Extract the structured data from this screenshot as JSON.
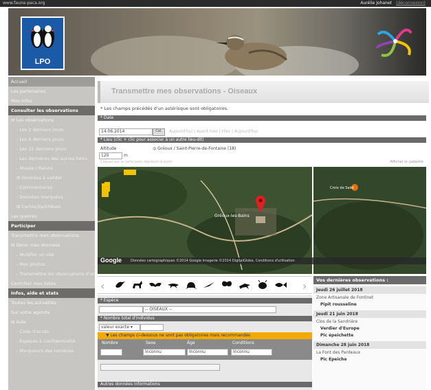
{
  "topbar": {
    "site": "www.faune-paca.org",
    "user": "Aurélie Johanet",
    "logout": "(déconnexion)"
  },
  "logo": {
    "text": "LPO"
  },
  "sidebar": {
    "items": [
      {
        "label": "Accueil",
        "type": "top"
      },
      {
        "label": "Les partenaires",
        "type": "item"
      },
      {
        "label": "Mes infos",
        "type": "item"
      },
      {
        "label": "Consulter les observations",
        "type": "head"
      },
      {
        "label": "⊟ Les observations",
        "type": "item"
      },
      {
        "label": "- Les 2 derniers jours",
        "type": "sub"
      },
      {
        "label": "- Les 5 derniers jours",
        "type": "sub"
      },
      {
        "label": "- Les 15 derniers jours",
        "type": "sub"
      },
      {
        "label": "- Les dernières des autres listes",
        "type": "sub"
      },
      {
        "label": "- Musée / Rareté",
        "type": "sub"
      },
      {
        "label": "⊞ Données à valider",
        "type": "sub"
      },
      {
        "label": "- Commentaires",
        "type": "sub"
      },
      {
        "label": "- Données marquées",
        "type": "sub"
      },
      {
        "label": "⊞ Cartes/Synthèses",
        "type": "sub"
      },
      {
        "label": "Les guerres",
        "type": "item"
      },
      {
        "label": "Participer",
        "type": "head"
      },
      {
        "label": "Transmettre mes observations",
        "type": "item"
      },
      {
        "label": "⊟ Gérer mes données",
        "type": "item"
      },
      {
        "label": "- Modifier un site",
        "type": "sub"
      },
      {
        "label": "- Mes photos",
        "type": "sub"
      },
      {
        "label": "- Transmettre les observations d'un ...",
        "type": "sub"
      },
      {
        "label": "Contrôler mes listes",
        "type": "item"
      },
      {
        "label": "Infos, aide et stats",
        "type": "head"
      },
      {
        "label": "Toutes les actualités",
        "type": "item"
      },
      {
        "label": "Sur votre agenda",
        "type": "item"
      },
      {
        "label": "⊟ Aide",
        "type": "item"
      },
      {
        "label": "- Code d'accès",
        "type": "sub"
      },
      {
        "label": "- Espèces à confidentialité",
        "type": "sub"
      },
      {
        "label": "- Marqueurs des nombres",
        "type": "sub"
      }
    ]
  },
  "main": {
    "title": "Transmettre mes observations - Oiseaux",
    "required_note": "* Les champs précédés d'un astérisque sont obligatoires.",
    "date_bar": "* Date",
    "date_value": "14.06.2014",
    "date_button": "Cal.",
    "date_links": "Aujourd'hui | Avant-hier | Hier | Aujourd'hui",
    "lieu_bar": "* Lieu (clic + clic pour associer à un autre lieu-dit)",
    "lieu_label": "Altitude",
    "lieu_value": "◎ Gréoux / Saint-Pierre-de-Fontaine (18)",
    "altitude_value": "120",
    "altitude_unit": "m",
    "lieu_hint": "Cliquez sur la carte pour déplacer le point",
    "lieu_hint2": "Afficher le cadastre",
    "google": "Google",
    "map_footer": "Données cartographiques ©2014 Google Imagerie ©2014 DigitalGlobe, Conditions d'utilisation",
    "map_marker_label": "Gréoux-les-Bains",
    "map_place2": "Croix de Saint"
  },
  "species_bar": {
    "left_arrow": "‹",
    "right_arrow": "›"
  },
  "form": {
    "species_bar": "* Espèce",
    "species_placeholder": "-- OISEAUX --",
    "count_bar": "* Nombre total d'individus",
    "count_select": "valeur exacte ▾",
    "yellow_bar": "▼ Les champs ci-dessous ne sont pas obligatoires mais recommandés",
    "col_number": "Nombre",
    "col_sex": "Sexe",
    "col_age": "Âge",
    "col_conditions": "Conditions",
    "sex_select": "Inconnu",
    "age_select": "Inconnu",
    "cond_select": "Inconnu",
    "extra": "Autres données informations"
  },
  "recent": {
    "title": "Vos dernières observations :",
    "groups": [
      {
        "date": "Jeudi 26 juillet 2018",
        "place": "Zone Artisanale de Fontinet",
        "obs": [
          "Pipit rousseline"
        ]
      },
      {
        "date": "Jeudi 21 juin 2018",
        "place": "Clos de la Sandrière",
        "obs": [
          "Verdier d'Europe",
          "Pic épeichette"
        ]
      },
      {
        "date": "Dimanche 28 juin 2018",
        "place": "La Font des Pardeaux",
        "obs": [
          "Pic Epeiche"
        ]
      }
    ]
  },
  "colors": {
    "header_grey": "#6a6a6a",
    "accent_orange": "#f2a900",
    "sidebar_bg": "#c8c6c2",
    "logo_blue": "#1b5aa6"
  }
}
